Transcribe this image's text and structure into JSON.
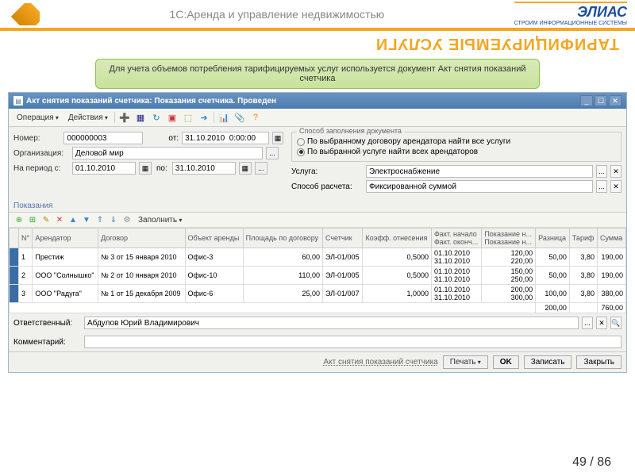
{
  "header": {
    "title": "1С:Аренда и управление недвижимостью",
    "logo": "ЭЛИАС",
    "logo_sub": "СТРОИМ ИНФОРМАЦИОННЫЕ СИСТЕМЫ"
  },
  "slide_title": "ТАРИФИЦИРУЕМЫЕ УСЛУГИ",
  "green_note": "Для учета объемов потребления тарифицируемых услуг используется документ Акт снятия показаний счетчика",
  "window": {
    "title": "Акт снятия показаний счетчика: Показания счетчика. Проведен",
    "menu_operation": "Операция",
    "menu_actions": "Действия"
  },
  "form": {
    "number_label": "Номер:",
    "number_value": "000000003",
    "from_label": "от:",
    "from_value": "31.10.2010  0:00:00",
    "org_label": "Организация:",
    "org_value": "Деловой мир",
    "period_label": "На период с:",
    "period_from": "01.10.2010",
    "period_to_label": "по:",
    "period_to": "31.10.2010",
    "fill_method_legend": "Способ заполнения документа",
    "radio1": "По выбранному договору арендатора найти все услуги",
    "radio2": "По выбранной услуге найти всех арендаторов",
    "service_label": "Услуга:",
    "service_value": "Электроснабжение",
    "calc_label": "Способ расчета:",
    "calc_value": "Фиксированной суммой"
  },
  "section": "Показания",
  "fill_menu": "Заполнить",
  "columns": {
    "n": "N°",
    "tenant": "Арендатор",
    "contract": "Договор",
    "object": "Объект аренды",
    "area": "Площадь по договору",
    "meter": "Счетчик",
    "coef": "Коэфф. отнесения",
    "fact_start": "Факт. начало",
    "fact_end": "Факт. оконч...",
    "reading_start": "Показание н...",
    "reading_end": "Показание н...",
    "diff": "Разница",
    "tariff": "Тариф",
    "sum": "Сумма"
  },
  "rows": [
    {
      "n": "1",
      "tenant": "Престиж",
      "contract": "№ 3 от 15 января 2010",
      "object": "Офис-3",
      "area": "60,00",
      "meter": "ЭЛ-01/005",
      "coef": "0,5000",
      "fstart": "01.10.2010",
      "fend": "31.10.2010",
      "rstart": "120,00",
      "rend": "220,00",
      "diff": "50,00",
      "tariff": "3,80",
      "sum": "190,00"
    },
    {
      "n": "2",
      "tenant": "ООО \"Солнышко\"",
      "contract": "№ 2 от 10 января 2010",
      "object": "Офис-10",
      "area": "110,00",
      "meter": "ЭЛ-01/005",
      "coef": "0,5000",
      "fstart": "01.10.2010",
      "fend": "31.10.2010",
      "rstart": "150,00",
      "rend": "250,00",
      "diff": "50,00",
      "tariff": "3,80",
      "sum": "190,00"
    },
    {
      "n": "3",
      "tenant": "ООО \"Радуга\"",
      "contract": "№ 1 от 15 декабря 2009",
      "object": "Офис-6",
      "area": "25,00",
      "meter": "ЭЛ-01/007",
      "coef": "1,0000",
      "fstart": "01.10.2010",
      "fend": "31.10.2010",
      "rstart": "200,00",
      "rend": "300,00",
      "diff": "100,00",
      "tariff": "3,80",
      "sum": "380,00"
    }
  ],
  "totals": {
    "diff": "200,00",
    "sum": "760,00"
  },
  "footer": {
    "resp_label": "Ответственный:",
    "resp_value": "Абдулов Юрий Владимирович",
    "comment_label": "Комментарий:",
    "doc_link": "Акт снятия показаний счетчика",
    "print": "Печать",
    "ok": "OK",
    "save": "Записать",
    "close": "Закрыть"
  },
  "page": {
    "current": "49",
    "total": "86",
    "sep": " / "
  }
}
